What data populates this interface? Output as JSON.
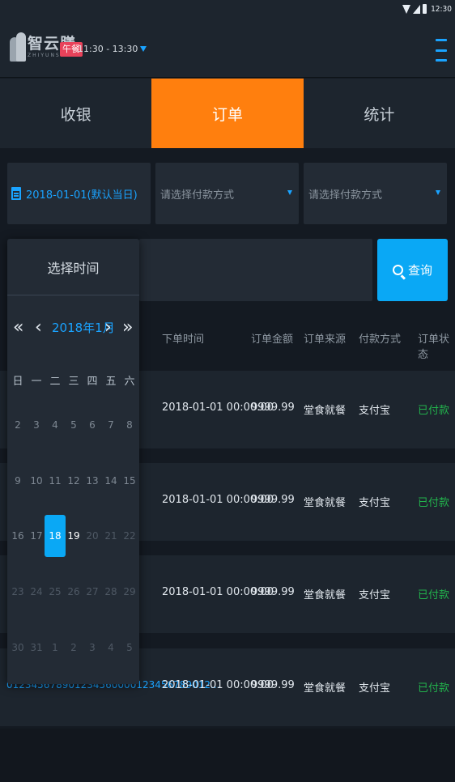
{
  "status_bar": {
    "time": "12:30"
  },
  "header": {
    "logo_name": "智云膳",
    "logo_sub": "ZHIYUNSHAN",
    "meal_badge": "午餐",
    "meal_time": "11:30 - 13:30"
  },
  "tabs": [
    {
      "label": "收银"
    },
    {
      "label": "订单"
    },
    {
      "label": "统计"
    }
  ],
  "filters": {
    "date_value": "2018-01-01(默认当日)",
    "payment_placeholder_1": "请选择付款方式",
    "payment_placeholder_2": "请选择付款方式"
  },
  "search": {
    "query_label": "查询"
  },
  "table": {
    "headers": [
      "下单时间",
      "订单金额",
      "订单来源",
      "付款方式",
      "订单状态"
    ],
    "rows": [
      {
        "time": "2018-01-01   00:00:00",
        "amount": "9999.99",
        "source": "堂食就餐",
        "payment": "支付宝",
        "status": "已付款"
      },
      {
        "time": "2018-01-01   00:00:00",
        "amount": "9999.99",
        "source": "堂食就餐",
        "payment": "支付宝",
        "status": "已付款"
      },
      {
        "time": "2018-01-01   00:00:00",
        "amount": "9999.99",
        "source": "堂食就餐",
        "payment": "支付宝",
        "status": "已付款"
      },
      {
        "id": "0123456789012345600001234567890​12...",
        "time": "2018-01-01   00:00:00",
        "amount": "9999.99",
        "source": "堂食就餐",
        "payment": "支付宝",
        "status": "已付款"
      }
    ]
  },
  "date_picker": {
    "title": "选择时间",
    "month_label": "2018年1月",
    "nav": {
      "prev_year": "«",
      "prev_month": "‹",
      "next_month": "›",
      "next_year": "»"
    },
    "weekdays": [
      "日",
      "一",
      "二",
      "三",
      "四",
      "五",
      "六"
    ],
    "weeks": [
      [
        "2",
        "3",
        "4",
        "5",
        "6",
        "7",
        "8"
      ],
      [
        "9",
        "10",
        "11",
        "12",
        "13",
        "14",
        "15"
      ],
      [
        "16",
        "17",
        "18",
        "19",
        "20",
        "21",
        "22"
      ],
      [
        "23",
        "24",
        "25",
        "26",
        "27",
        "28",
        "29"
      ],
      [
        "30",
        "31",
        "1",
        "2",
        "3",
        "4",
        "5"
      ]
    ],
    "selected_day": "18"
  },
  "colors": {
    "accent_orange": "#ff7f0e",
    "accent_blue": "#1aa3ff",
    "paid_green": "#22b24c",
    "badge_red": "#e8425a"
  }
}
